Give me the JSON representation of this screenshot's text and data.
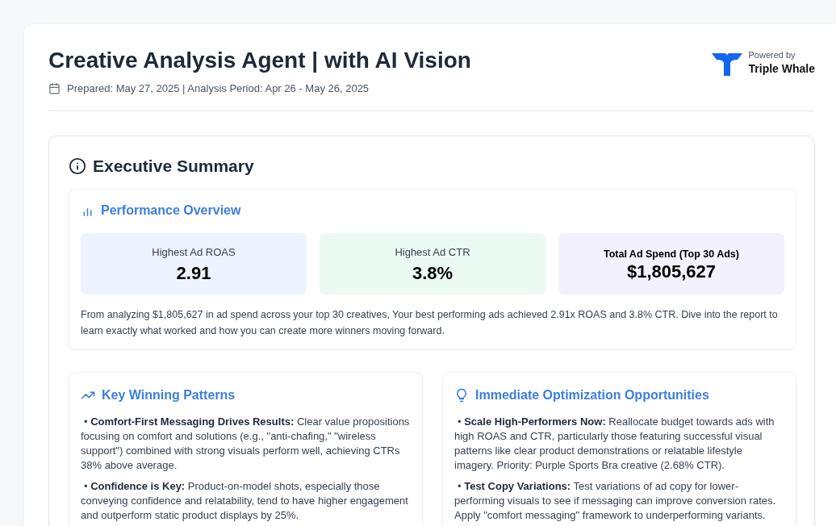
{
  "header": {
    "title": "Creative Analysis Agent | with AI Vision",
    "subtitle": "Prepared: May 27, 2025 | Analysis Period: Apr 26 - May 26, 2025",
    "powered_by": "Powered by",
    "brand": "Triple Whale"
  },
  "executive_summary": {
    "title": "Executive Summary",
    "performance_overview": {
      "title": "Performance Overview",
      "metrics": [
        {
          "label": "Highest Ad ROAS",
          "value": "2.91",
          "color": "#eef4ff",
          "emphasis": false
        },
        {
          "label": "Highest Ad CTR",
          "value": "3.8%",
          "color": "#ebfaf2",
          "emphasis": false
        },
        {
          "label": "Total Ad Spend (Top 30 Ads)",
          "value": "$1,805,627",
          "color": "#f3f1fe",
          "emphasis": true
        }
      ],
      "summary": "From analyzing $1,805,627 in ad spend across your top 30 creatives, Your best performing ads achieved 2.91x ROAS and 3.8% CTR. Dive into the report to learn exactly what worked and how you can create more winners moving forward."
    },
    "panels": [
      {
        "kind": "trend",
        "title": "Key Winning Patterns",
        "items": [
          "•  **Comfort-First Messaging Drives Results:** Clear value propositions focusing on comfort and solutions (e.g., \"anti-chafing,\" \"wireless support\") combined with strong visuals perform well, achieving CTRs 38% above average.",
          "•  **Confidence is Key:**  Product-on-model shots, especially those conveying confidence and relatability, tend to have higher engagement and outperform static product displays by 25%."
        ]
      },
      {
        "kind": "bulb",
        "title": "Immediate Optimization Opportunities",
        "items": [
          "•  **Scale High-Performers Now:** Reallocate budget towards ads with high ROAS and CTR, particularly those featuring successful visual patterns like clear product demonstrations or relatable lifestyle imagery. Priority: Purple Sports Bra creative (2.68% CTR).",
          "•  **Test Copy Variations:** Test variations of ad copy for lower-performing visuals to see if messaging can improve conversion rates. Apply \"comfort messaging\" framework to underperforming variants."
        ]
      }
    ]
  }
}
